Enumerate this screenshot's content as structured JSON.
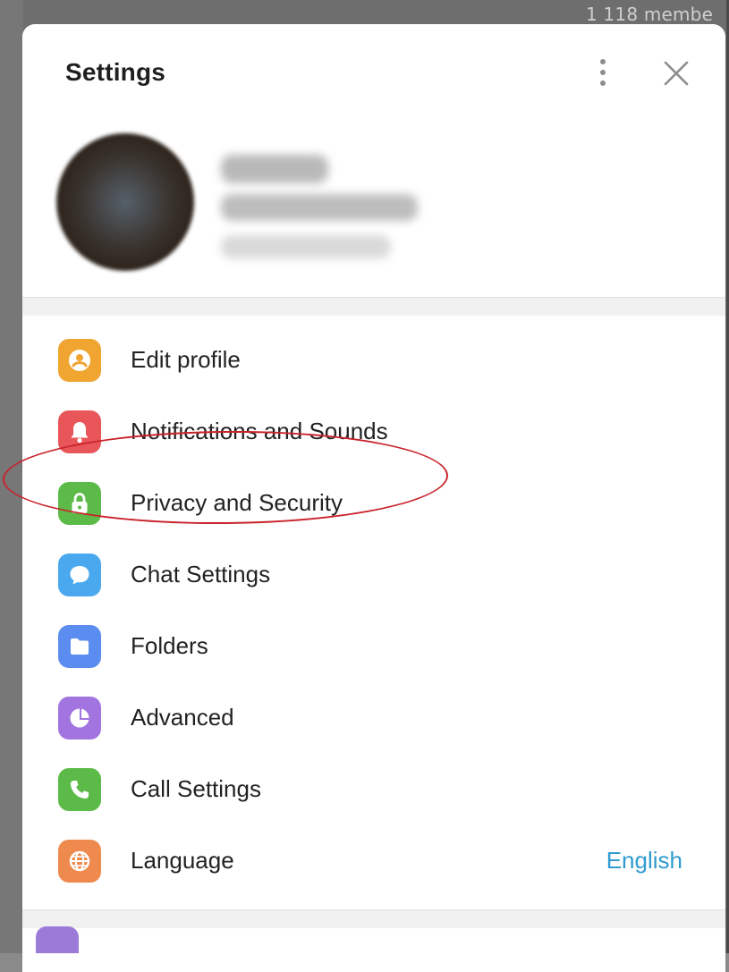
{
  "background": {
    "member_count_text": "1 118 membe"
  },
  "modal": {
    "title": "Settings",
    "profile": {
      "name": "",
      "phone": "",
      "username": ""
    },
    "items": [
      {
        "label": "Edit profile",
        "icon": "user-circle-icon",
        "color": "#f0a530",
        "value": ""
      },
      {
        "label": "Notifications and Sounds",
        "icon": "bell-icon",
        "color": "#e9565a",
        "value": ""
      },
      {
        "label": "Privacy and Security",
        "icon": "lock-icon",
        "color": "#5cbb48",
        "value": ""
      },
      {
        "label": "Chat Settings",
        "icon": "chat-bubble-icon",
        "color": "#4aa9ee",
        "value": ""
      },
      {
        "label": "Folders",
        "icon": "folder-icon",
        "color": "#5b8df0",
        "value": ""
      },
      {
        "label": "Advanced",
        "icon": "pie-chart-icon",
        "color": "#a174e0",
        "value": ""
      },
      {
        "label": "Call Settings",
        "icon": "phone-icon",
        "color": "#5cbb48",
        "value": ""
      },
      {
        "label": "Language",
        "icon": "globe-icon",
        "color": "#ef8a4e",
        "value": "English"
      }
    ]
  },
  "colors": {
    "accent": "#2f9bd0",
    "annotation": "#c9232b"
  }
}
